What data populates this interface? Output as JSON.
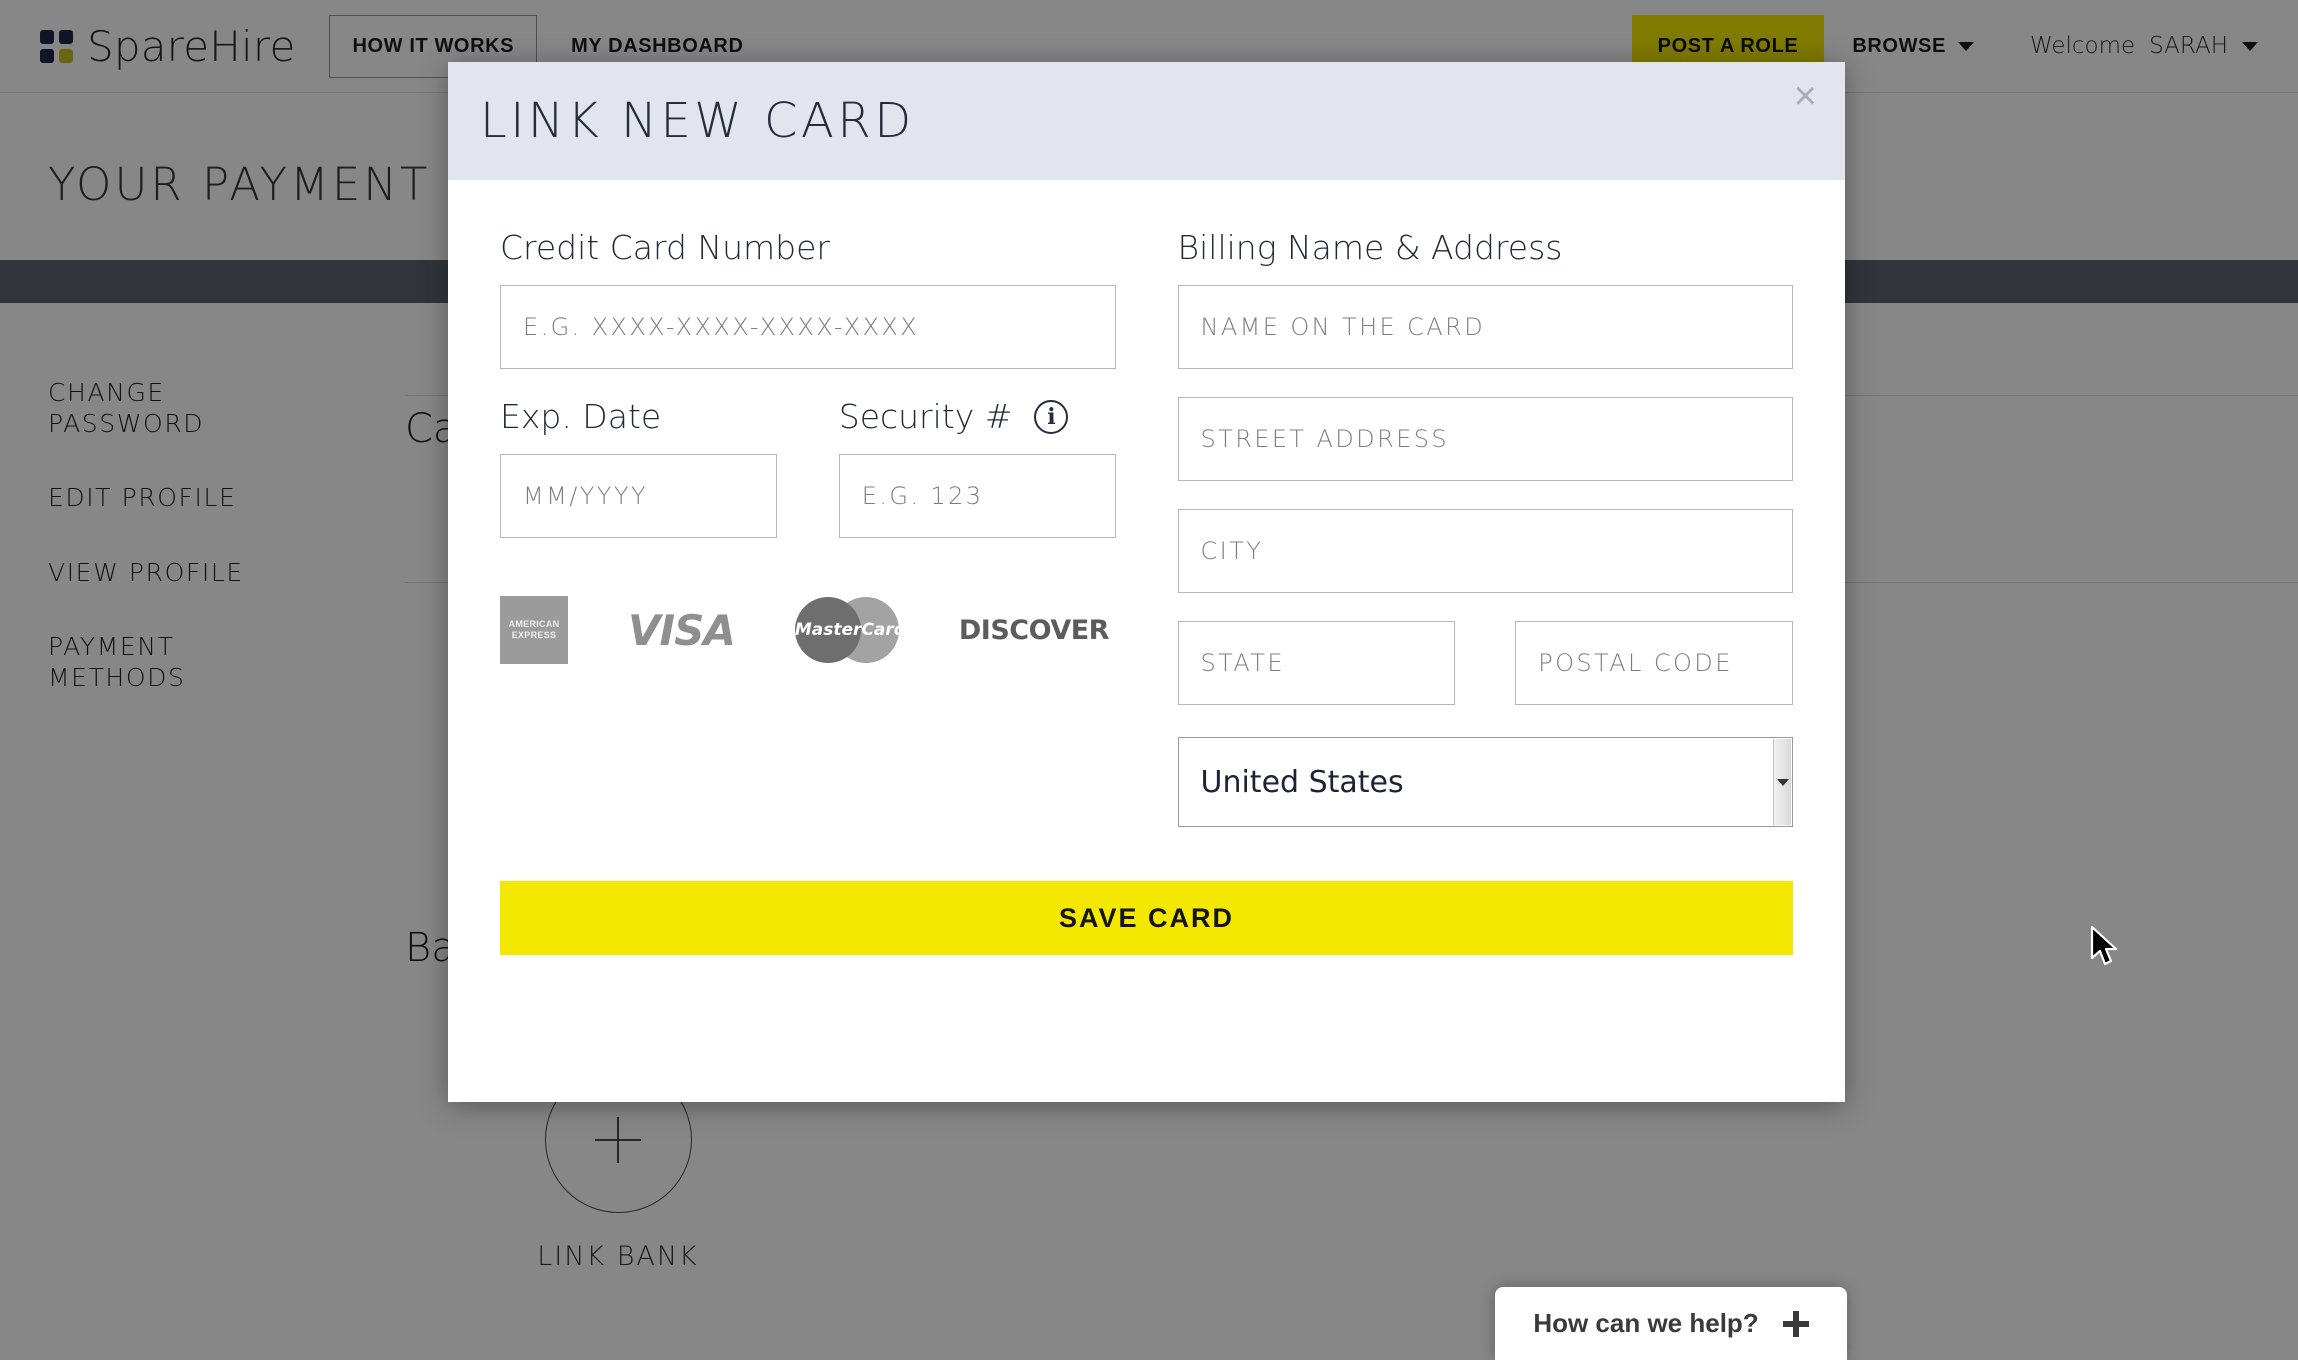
{
  "header": {
    "brand_name": "SpareHire",
    "logo_icon": "four-square-grid-icon",
    "nav": [
      {
        "label": "HOW IT WORKS",
        "style": "outline"
      },
      {
        "label": "MY DASHBOARD",
        "style": "plain"
      }
    ],
    "post_role_label": "POST A ROLE",
    "browse_label": "BROWSE",
    "welcome_prefix": "Welcome",
    "user_name": "SARAH",
    "accent_yellow": "#f2e800",
    "logo_navy": "#1f2b46",
    "logo_accent": "#c8bf20"
  },
  "page": {
    "title": "YOUR PAYMENT",
    "band_color": "#5d6370",
    "sidebar": [
      {
        "label": "CHANGE\nPASSWORD"
      },
      {
        "label": "EDIT PROFILE"
      },
      {
        "label": "VIEW PROFILE"
      },
      {
        "label": "PAYMENT\nMETHODS"
      }
    ],
    "cards_heading": "Ca",
    "banks_heading": "Ba",
    "link_bank": {
      "label": "LINK BANK",
      "icon": "plus-circle-icon"
    }
  },
  "help_widget": {
    "text": "How can we help?",
    "icon": "plus-icon"
  },
  "modal": {
    "title": "LINK NEW CARD",
    "close_label": "×",
    "header_bg": "#e2e5ee",
    "left": {
      "card_number_label": "Credit Card Number",
      "card_number_placeholder": "E.G. XXXX-XXXX-XXXX-XXXX",
      "exp_label": "Exp. Date",
      "exp_placeholder": "MM/YYYY",
      "security_label": "Security #",
      "security_placeholder": "E.G. 123",
      "security_info_icon": "info-circle-icon",
      "card_brands": [
        {
          "name": "american-express",
          "line1": "AMERICAN",
          "line2": "EXPRESS"
        },
        {
          "name": "visa",
          "text": "VISA"
        },
        {
          "name": "mastercard",
          "text": "MasterCard"
        },
        {
          "name": "discover",
          "text": "DISCOVER"
        }
      ]
    },
    "right": {
      "billing_label": "Billing Name & Address",
      "name_placeholder": "NAME ON THE CARD",
      "street_placeholder": "STREET ADDRESS",
      "city_placeholder": "CITY",
      "state_placeholder": "STATE",
      "postal_placeholder": "POSTAL CODE",
      "country_value": "United States",
      "country_arrow_icon": "chevron-down-icon"
    },
    "save_label": "SAVE CARD",
    "save_color": "#f5e800"
  }
}
